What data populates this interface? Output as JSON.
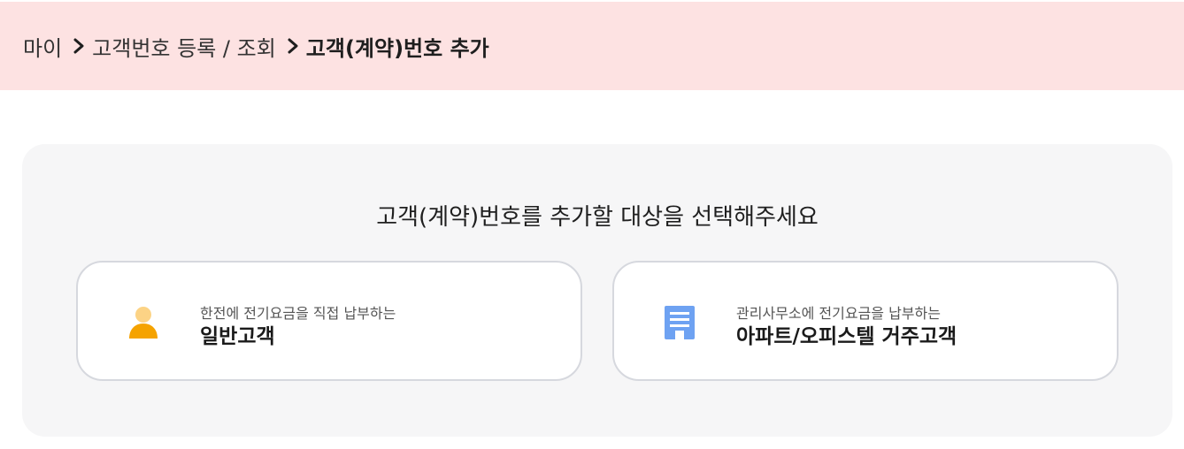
{
  "breadcrumb": {
    "items": [
      "마이",
      "고객번호 등록 / 조회"
    ],
    "current": "고객(계약)번호 추가"
  },
  "panel": {
    "title": "고객(계약)번호를 추가할 대상을 선택해주세요"
  },
  "options": [
    {
      "subtitle": "한전에 전기요금을 직접 납부하는",
      "title": "일반고객",
      "icon": "person-icon",
      "icon_color_head": "#fcd385",
      "icon_color_body": "#f5a300"
    },
    {
      "subtitle": "관리사무소에 전기요금을 납부하는",
      "title": "아파트/오피스텔 거주고객",
      "icon": "building-icon",
      "icon_color": "#6ea2f2"
    }
  ],
  "colors": {
    "header_bg": "#fde2e2",
    "panel_bg": "#f6f6f7",
    "card_border": "#d6d8de"
  }
}
